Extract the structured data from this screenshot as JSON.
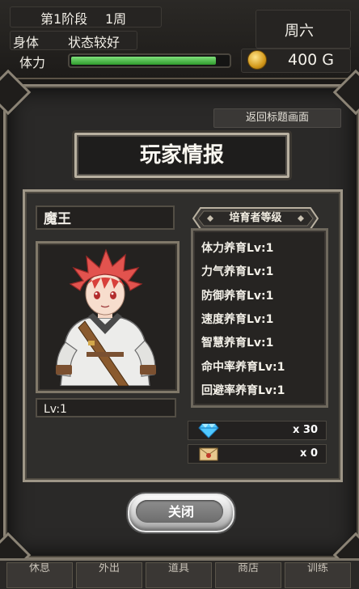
{
  "hud": {
    "stage": "第1阶段",
    "week": "1周",
    "body_label": "身体",
    "body_status": "状态较好",
    "day": "周六",
    "stamina_label": "体力",
    "stamina_fraction": 0.94,
    "gold": "400 G"
  },
  "panel": {
    "back_to_title": "返回标题画面",
    "title": "玩家情报",
    "player_name": "魔王",
    "level": "Lv:1",
    "trainer_level_header": "培育者等级",
    "skills": [
      "体力养育Lv:1",
      "力气养育Lv:1",
      "防御养育Lv:1",
      "速度养育Lv:1",
      "智慧养育Lv:1",
      "命中率养育Lv:1",
      "回避率养育Lv:1"
    ],
    "gems": "x 30",
    "letters": "x 0",
    "close": "关闭"
  },
  "nav": [
    "休息",
    "外出",
    "道具",
    "商店",
    "训练"
  ]
}
